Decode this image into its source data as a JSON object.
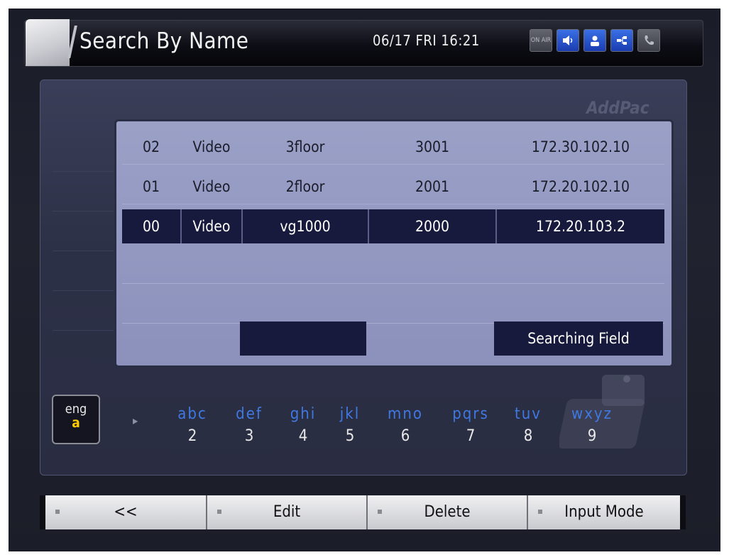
{
  "header": {
    "title": "Search By Name",
    "datetime": "06/17 FRI 16:21",
    "icons": [
      "on-air-icon",
      "speaker-icon",
      "user-icon",
      "network-icon",
      "phone-icon"
    ],
    "on_air_text": "ON AIR"
  },
  "brand": "AddPac",
  "list": {
    "rows": [
      {
        "id": "02",
        "type": "Video",
        "name": "3floor",
        "number": "3001",
        "ip": "172.30.102.10"
      },
      {
        "id": "01",
        "type": "Video",
        "name": "2floor",
        "number": "2001",
        "ip": "172.20.102.10"
      },
      {
        "id": "00",
        "type": "Video",
        "name": "vg1000",
        "number": "2000",
        "ip": "172.20.103.2"
      }
    ],
    "selected_index": 2,
    "searching_field_label": "Searching Field"
  },
  "input_mode": {
    "lang": "eng",
    "case": "a"
  },
  "keypad": [
    {
      "letters": "abc",
      "digit": "2"
    },
    {
      "letters": "def",
      "digit": "3"
    },
    {
      "letters": "ghi",
      "digit": "4"
    },
    {
      "letters": "jkl",
      "digit": "5"
    },
    {
      "letters": "mno",
      "digit": "6"
    },
    {
      "letters": "pqrs",
      "digit": "7"
    },
    {
      "letters": "tuv",
      "digit": "8"
    },
    {
      "letters": "wxyz",
      "digit": "9"
    }
  ],
  "softkeys": [
    {
      "label": "<<"
    },
    {
      "label": "Edit"
    },
    {
      "label": "Delete"
    },
    {
      "label": "Input Mode"
    }
  ],
  "colors": {
    "selected_row": "#171a3c",
    "list_bg": "#9aa0c6",
    "keypad_letters": "#3f78e0",
    "icon_blue": "#2a55d0"
  }
}
